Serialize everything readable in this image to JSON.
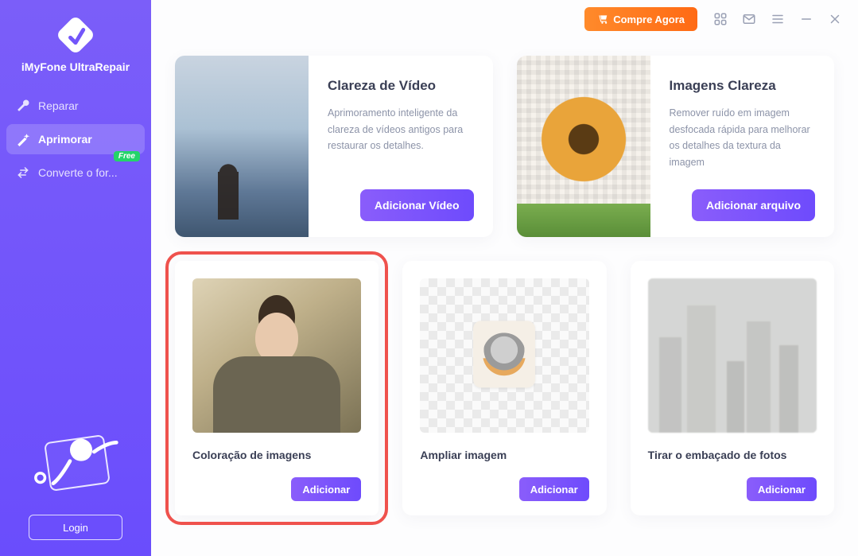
{
  "app": {
    "name": "iMyFone UltraRepair"
  },
  "sidebar": {
    "items": [
      {
        "label": "Reparar"
      },
      {
        "label": "Aprimorar"
      },
      {
        "label": "Converte o for...",
        "badge": "Free"
      }
    ],
    "login": "Login"
  },
  "topbar": {
    "buy_label": "Compre Agora"
  },
  "cards_top": [
    {
      "title": "Clareza de Vídeo",
      "desc": "Aprimoramento inteligente da clareza de vídeos antigos para restaurar os detalhes.",
      "button": "Adicionar Vídeo"
    },
    {
      "title": "Imagens Clareza",
      "desc": "Remover ruído em imagem desfocada rápida  para melhorar os detalhes da textura da imagem",
      "button": "Adicionar arquivo"
    }
  ],
  "cards_bottom": [
    {
      "title": "Coloração de imagens",
      "button": "Adicionar"
    },
    {
      "title": "Ampliar imagem",
      "button": "Adicionar"
    },
    {
      "title": "Tirar o embaçado de fotos",
      "button": "Adicionar"
    }
  ]
}
